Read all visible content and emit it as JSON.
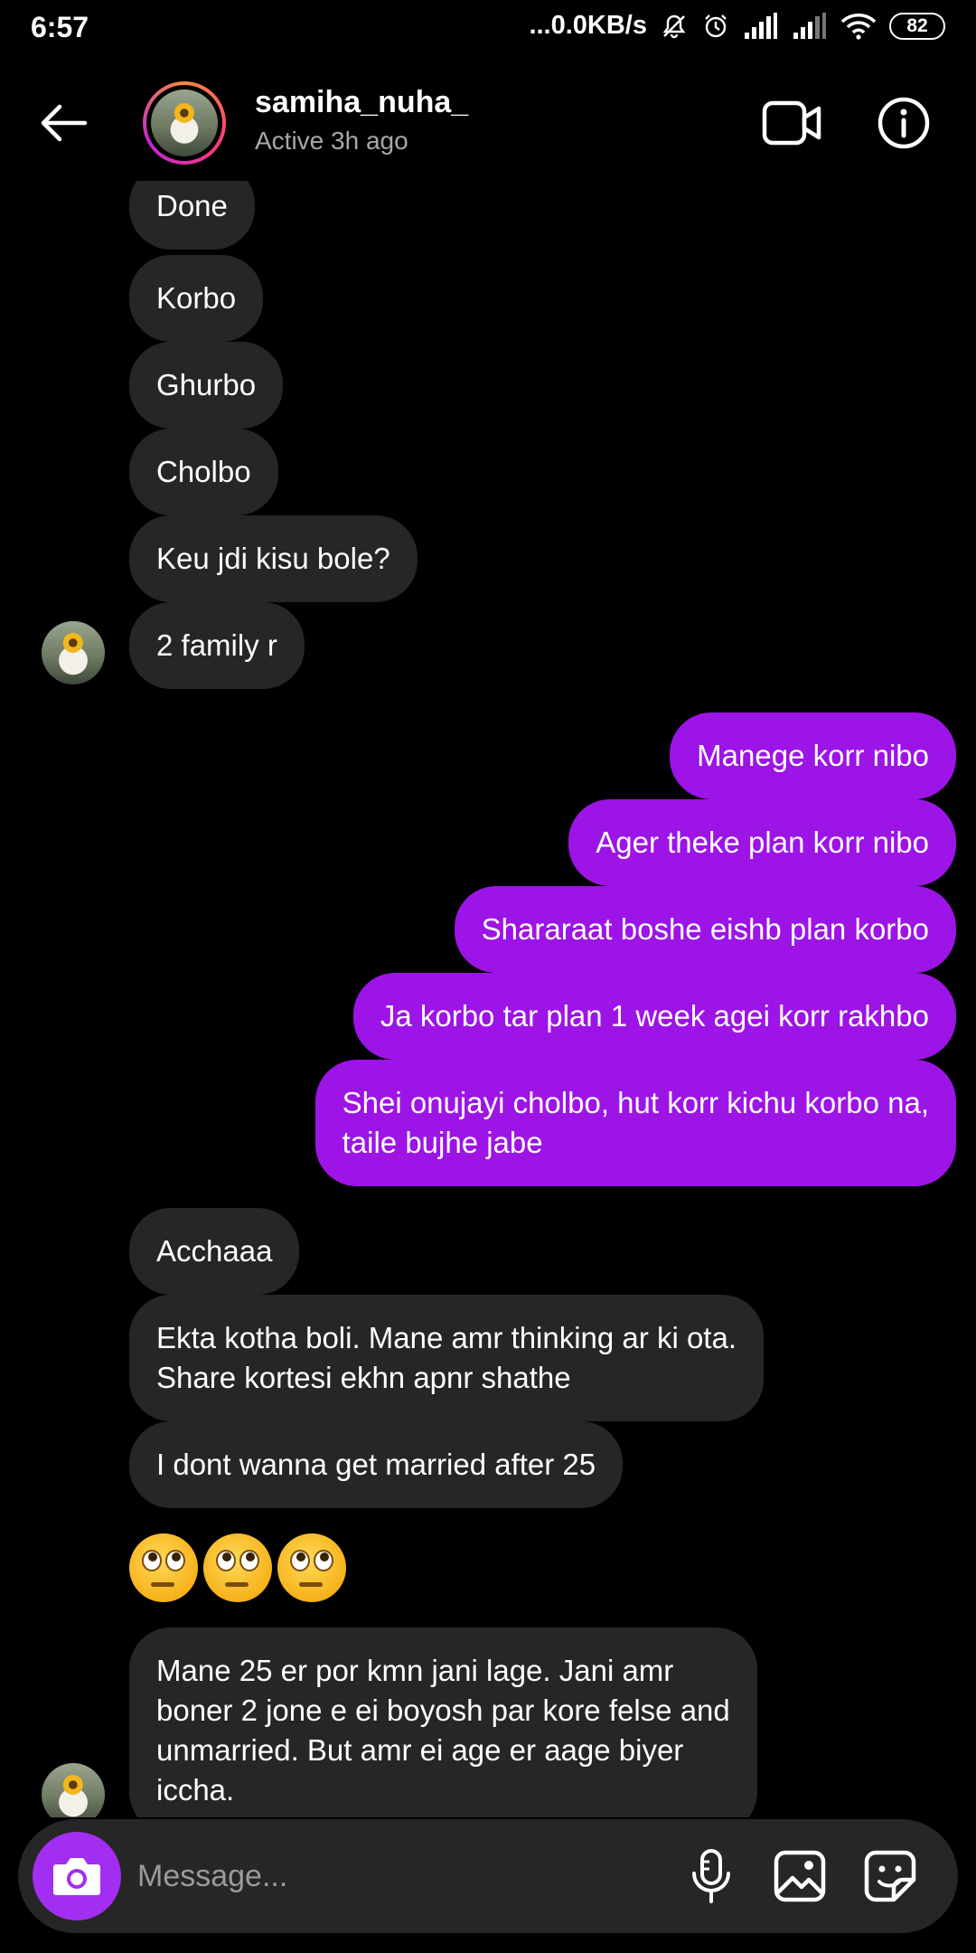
{
  "status_bar": {
    "time": "6:57",
    "network_speed": "...0.0KB/s",
    "battery": "82",
    "icons": [
      "mute-icon",
      "alarm-icon",
      "signal-icon",
      "signal-icon",
      "wifi-icon",
      "battery-icon"
    ]
  },
  "header": {
    "username": "samiha_nuha_",
    "active_status": "Active 3h ago",
    "icons": [
      "back-arrow-icon",
      "video-call-icon",
      "info-icon"
    ]
  },
  "messages": [
    {
      "side": "in",
      "text": "Done"
    },
    {
      "side": "in",
      "text": "Korbo"
    },
    {
      "side": "in",
      "text": "Ghurbo"
    },
    {
      "side": "in",
      "text": "Cholbo"
    },
    {
      "side": "in",
      "text": "Keu jdi kisu bole?"
    },
    {
      "side": "in",
      "text": "2 family r"
    },
    {
      "side": "out",
      "text": "Manege korr nibo"
    },
    {
      "side": "out",
      "text": "Ager theke plan korr nibo"
    },
    {
      "side": "out",
      "text": "Shararaat boshe eishb plan korbo"
    },
    {
      "side": "out",
      "text": "Ja korbo tar plan 1 week agei korr rakhbo"
    },
    {
      "side": "out",
      "text": "Shei onujayi cholbo, hut korr kichu korbo na,\ntaile bujhe jabe"
    },
    {
      "side": "in",
      "text": "Acchaaa"
    },
    {
      "side": "in",
      "text": "Ekta kotha boli. Mane amr thinking ar ki ota.\nShare kortesi ekhn apnr shathe"
    },
    {
      "side": "in",
      "text": "I dont wanna get married after 25"
    },
    {
      "side": "in",
      "emoji": [
        "face-with-rolling-eyes",
        "face-with-rolling-eyes",
        "face-with-rolling-eyes"
      ]
    },
    {
      "side": "in",
      "text": "Mane 25 er por kmn jani lage. Jani amr\nboner 2 jone e ei boyosh par kore felse and\nunmarried. But amr ei age er aage biyer\niccha."
    }
  ],
  "composer": {
    "placeholder": "Message...",
    "icons": [
      "camera-icon",
      "microphone-icon",
      "gallery-icon",
      "sticker-icon"
    ]
  },
  "colors": {
    "background": "#000000",
    "incoming_bubble": "#262626",
    "outgoing_bubble": "#9d14e6",
    "camera_button": "#a12ef0",
    "secondary_text": "#a8a8a8"
  }
}
